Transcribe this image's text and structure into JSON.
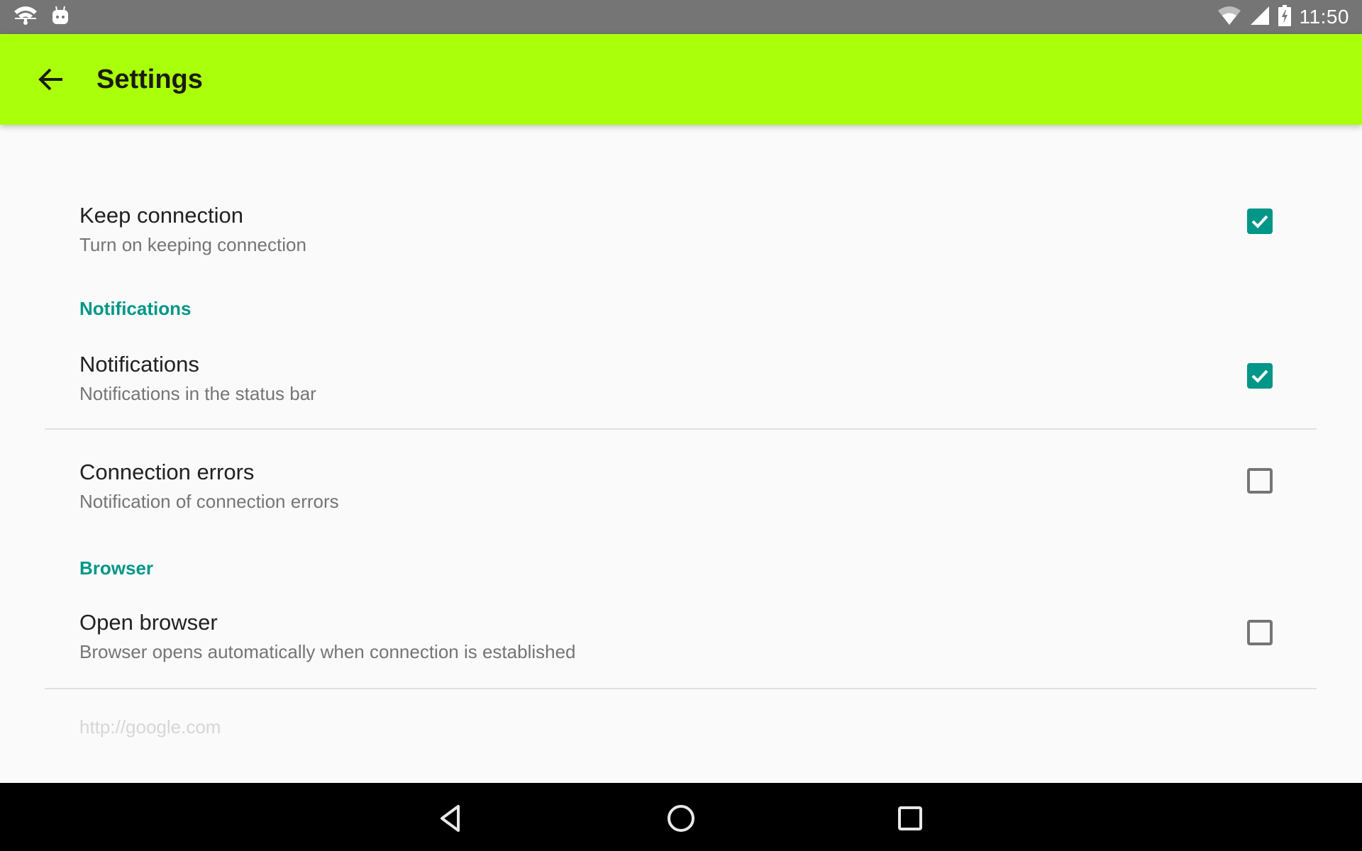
{
  "status_bar": {
    "left_icons": [
      "wifi-notification-icon",
      "android-notification-icon"
    ],
    "right_icons": [
      "wifi-signal-icon",
      "cell-signal-icon",
      "battery-charging-icon"
    ],
    "time": "11:50",
    "background_color": "#757575"
  },
  "toolbar": {
    "back_icon": "arrow-back-icon",
    "title": "Settings",
    "background_color": "#aaff0a"
  },
  "preferences": {
    "keep_connection": {
      "title": "Keep connection",
      "summary": "Turn on keeping connection",
      "checked": true
    },
    "notifications_category": "Notifications",
    "notifications": {
      "title": "Notifications",
      "summary": "Notifications in the status bar",
      "checked": true
    },
    "connection_errors": {
      "title": "Connection errors",
      "summary": "Notification of connection errors",
      "checked": false
    },
    "browser_category": "Browser",
    "open_browser": {
      "title": "Open browser",
      "summary": "Browser opens automatically when connection is established",
      "checked": false
    },
    "browser_url": "http://google.com"
  },
  "colors": {
    "accent": "#009688",
    "primary": "#aaff0a",
    "text_primary": "#212121",
    "text_secondary": "#757575",
    "text_disabled": "#d6d6d6"
  },
  "nav_bar": {
    "buttons": [
      "back-triangle-icon",
      "home-circle-icon",
      "recents-square-icon"
    ]
  }
}
